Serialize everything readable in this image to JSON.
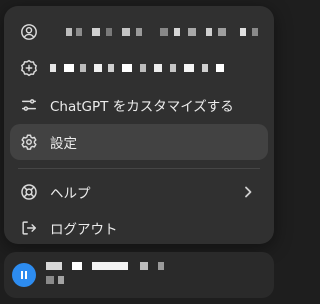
{
  "menu": {
    "items": [
      {
        "label": ""
      },
      {
        "label": ""
      },
      {
        "label": "ChatGPT をカスタマイズする"
      },
      {
        "label": "設定"
      },
      {
        "label": "ヘルプ"
      },
      {
        "label": "ログアウト"
      }
    ]
  },
  "colors": {
    "menu_bg": "#303030",
    "active_bg": "#424242",
    "avatar": "#2d8cf0"
  }
}
